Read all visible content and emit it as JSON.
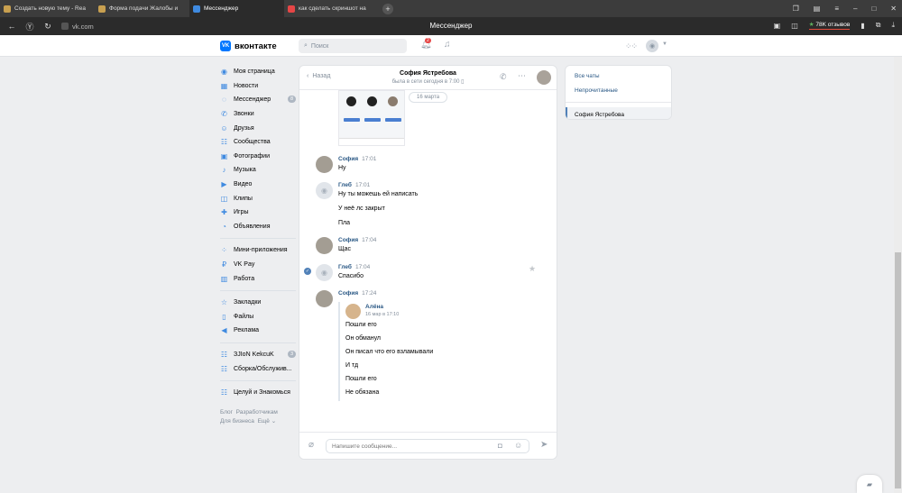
{
  "browser": {
    "tabs": [
      {
        "title": "Создать новую тему - Rea",
        "color": "#c8a050"
      },
      {
        "title": "Форма подачи Жалобы и",
        "color": "#c8a050"
      },
      {
        "title": "Мессенджер",
        "color": "#3f8ae0"
      },
      {
        "title": "как сделать скриншот на",
        "color": "#e64646"
      }
    ],
    "url": "vk.com",
    "page_title": "Мессенджер",
    "reviews": "78K отзывов"
  },
  "header": {
    "logo_text": "вконтакте",
    "search_placeholder": "Поиск",
    "notifications_count": "2"
  },
  "nav": {
    "items": [
      {
        "label": "Моя страница",
        "icon": "user-icon"
      },
      {
        "label": "Новости",
        "icon": "news-icon"
      },
      {
        "label": "Мессенджер",
        "icon": "message-icon",
        "count": "8"
      },
      {
        "label": "Звонки",
        "icon": "phone-icon"
      },
      {
        "label": "Друзья",
        "icon": "friends-icon"
      },
      {
        "label": "Сообщества",
        "icon": "groups-icon"
      },
      {
        "label": "Фотографии",
        "icon": "photo-icon"
      },
      {
        "label": "Музыка",
        "icon": "music-icon"
      },
      {
        "label": "Видео",
        "icon": "video-icon"
      },
      {
        "label": "Клипы",
        "icon": "clips-icon"
      },
      {
        "label": "Игры",
        "icon": "games-icon"
      },
      {
        "label": "Объявления",
        "icon": "ads-icon"
      }
    ],
    "items2": [
      {
        "label": "Мини-приложения",
        "icon": "apps-icon"
      },
      {
        "label": "VK Pay",
        "icon": "vkpay-icon"
      },
      {
        "label": "Работа",
        "icon": "work-icon"
      }
    ],
    "items3": [
      {
        "label": "Закладки",
        "icon": "bookmark-icon"
      },
      {
        "label": "Файлы",
        "icon": "file-icon"
      },
      {
        "label": "Реклама",
        "icon": "megaphone-icon"
      }
    ],
    "items4": [
      {
        "label": "ЗJIoN KekcuK",
        "icon": "group-icon",
        "count": "3"
      },
      {
        "label": "Сборка/Обслужив...",
        "icon": "group-icon"
      }
    ],
    "items5": [
      {
        "label": "Целуй и Знакомься",
        "icon": "group-icon"
      }
    ],
    "footer": [
      "Блог",
      "Разработчикам",
      "Для бизнеса",
      "Ещё"
    ]
  },
  "chat": {
    "back": "Назад",
    "name": "София Ястребова",
    "status": "была в сети сегодня в 7:00",
    "date": "16 марта",
    "messages": [
      {
        "author": "София",
        "time": "17:01",
        "lines": [
          "Ну"
        ]
      },
      {
        "author": "Глеб",
        "time": "17:01",
        "lines": [
          "Ну ты можешь ей написать",
          "У неё лс закрыт",
          "Пла"
        ]
      },
      {
        "author": "София",
        "time": "17:04",
        "lines": [
          "Щас"
        ]
      },
      {
        "author": "Глеб",
        "time": "17:04",
        "lines": [
          "Спасибо"
        ]
      },
      {
        "author": "София",
        "time": "17:24",
        "lines": []
      }
    ],
    "forwarded": {
      "author": "Алёна",
      "date": "16 мар в 17:10",
      "lines": [
        "Пошли его",
        "Он обманул",
        "Он писал что его взламывали",
        "И тд",
        "Пошли его",
        "Не обязана"
      ]
    },
    "input_placeholder": "Напишите сообщение..."
  },
  "filters": {
    "all": "Все чаты",
    "unread": "Непрочитанные",
    "selected": "София Ястребова"
  }
}
